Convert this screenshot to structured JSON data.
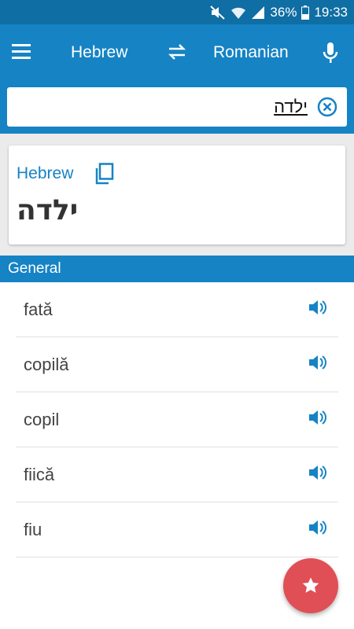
{
  "status_bar": {
    "battery": "36%",
    "time": "19:33"
  },
  "app_bar": {
    "source_language": "Hebrew",
    "target_language": "Romanian"
  },
  "search": {
    "query": "ילדה"
  },
  "source_card": {
    "language": "Hebrew",
    "word": "ילדה"
  },
  "section": {
    "title": "General"
  },
  "results": [
    {
      "text": "fată"
    },
    {
      "text": "copilă"
    },
    {
      "text": "copil"
    },
    {
      "text": "fiică"
    },
    {
      "text": "fiu"
    }
  ],
  "colors": {
    "primary": "#1583c4",
    "status_bar": "#0f6ea3",
    "fab": "#e04f55"
  }
}
